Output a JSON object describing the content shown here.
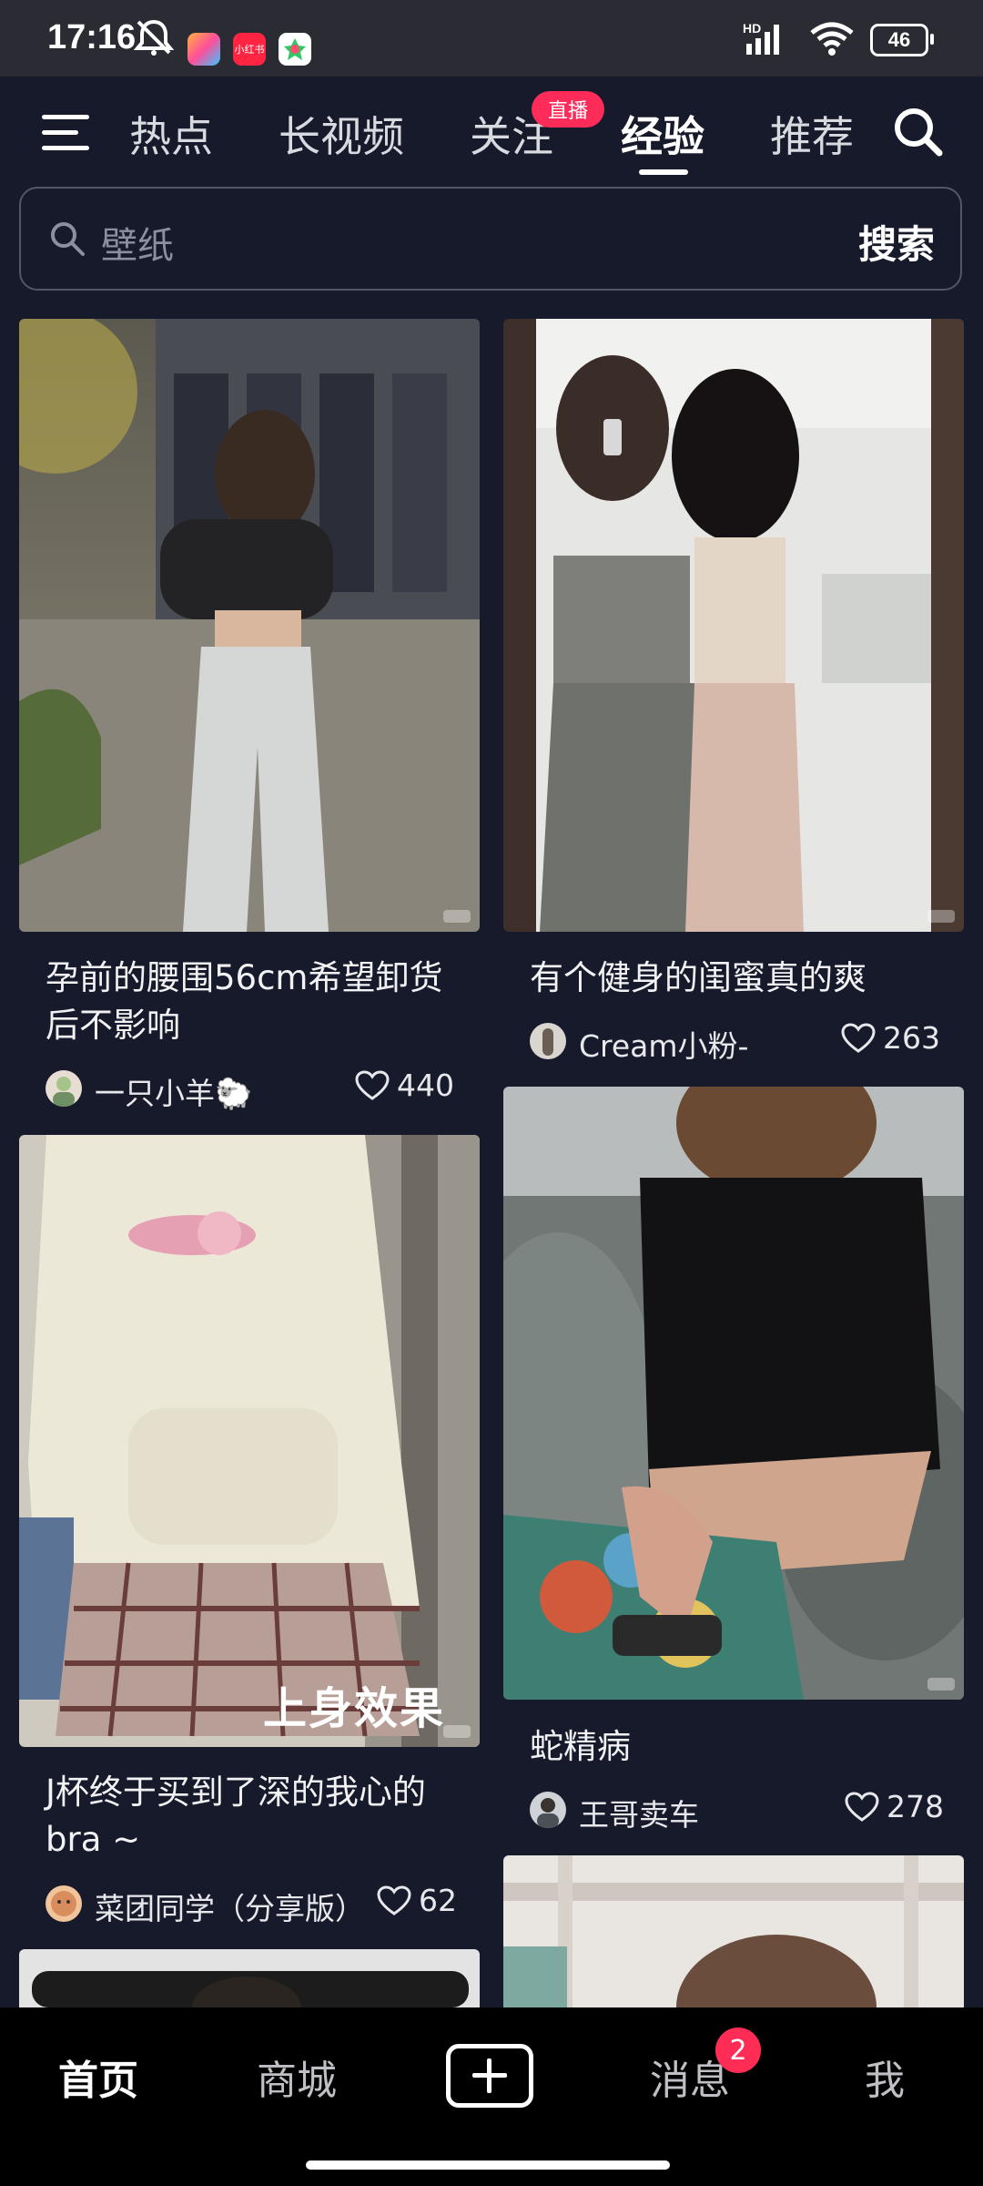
{
  "status_bar": {
    "time": "17:16",
    "battery": "46",
    "network": "HD",
    "app_icons": [
      "game-center-icon",
      "xiaohongshu-icon",
      "photos-icon"
    ],
    "icons": [
      "mute-icon",
      "signal-icon",
      "wifi-icon",
      "battery-icon"
    ]
  },
  "top_nav": {
    "tabs": [
      {
        "label": "热点",
        "active": false
      },
      {
        "label": "长视频",
        "active": false
      },
      {
        "label": "关注",
        "active": false,
        "badge": "直播"
      },
      {
        "label": "经验",
        "active": true
      },
      {
        "label": "推荐",
        "active": false
      }
    ]
  },
  "search": {
    "placeholder": "壁纸",
    "button": "搜索"
  },
  "feed": {
    "left": [
      {
        "title": "孕前的腰围56cm希望卸货后不影响",
        "author": "一只小羊🐑",
        "likes": "440"
      },
      {
        "title": "J杯终于买到了深的我心的bra ~",
        "author": "菜团同学（分享版）",
        "likes": "62"
      }
    ],
    "right": [
      {
        "title": "有个健身的闺蜜真的爽",
        "author": "Cream小粉-",
        "likes": "263"
      },
      {
        "title": "蛇精病",
        "author": "王哥卖车",
        "likes": "278"
      }
    ],
    "overlay_text": "上身效果"
  },
  "bottom_nav": {
    "items": [
      "首页",
      "商城",
      "消息",
      "我"
    ],
    "message_badge": "2"
  },
  "colors": {
    "background": "#171a2b",
    "accent": "#ff2c55",
    "bottom_bar": "#000000"
  }
}
